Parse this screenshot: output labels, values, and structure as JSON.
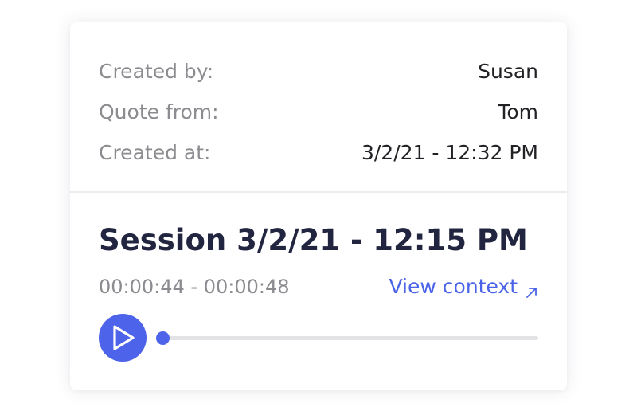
{
  "meta": {
    "rows": [
      {
        "label": "Created by:",
        "value": "Susan"
      },
      {
        "label": "Quote from:",
        "value": "Tom"
      },
      {
        "label": "Created at:",
        "value": "3/2/21 - 12:32 PM"
      }
    ]
  },
  "session": {
    "title": "Session 3/2/21 - 12:15 PM",
    "time_range": "00:00:44 - 00:00:48",
    "view_context_label": "View context",
    "view_context_icon": "arrow-up-right-icon",
    "progress": 0
  },
  "player": {
    "play_icon": "play-icon"
  },
  "colors": {
    "accent": "#4d63ea",
    "link": "#4a63e8",
    "title": "#22253f",
    "label": "#8b8b90",
    "value": "#222226",
    "track": "#e3e3e6"
  }
}
